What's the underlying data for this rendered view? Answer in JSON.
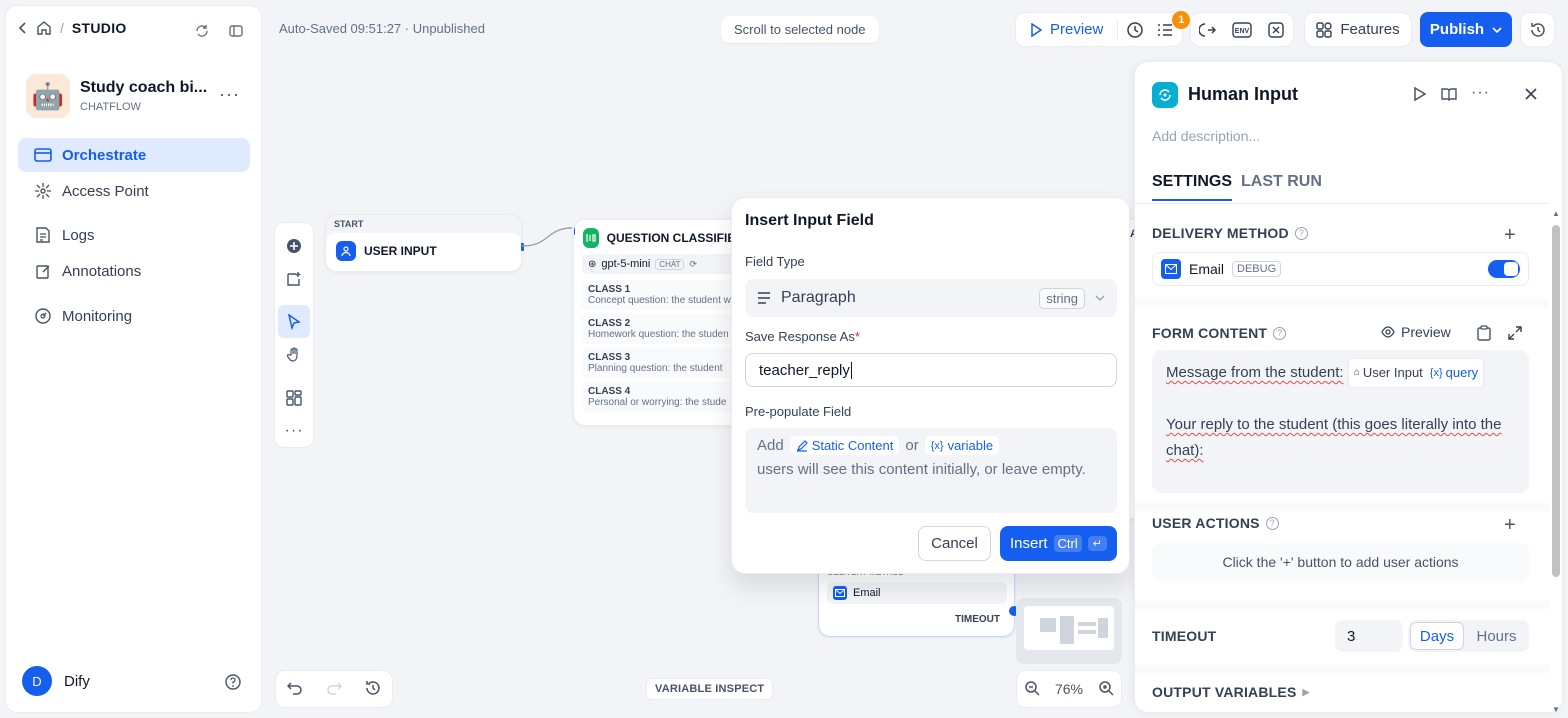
{
  "sidebar": {
    "studio": "STUDIO",
    "app_name": "Study coach bi...",
    "app_type": "CHATFLOW",
    "nav": [
      "Orchestrate",
      "Access Point",
      "Logs",
      "Annotations",
      "Monitoring"
    ],
    "user_initial": "D",
    "user_name": "Dify"
  },
  "header": {
    "autosave": "Auto-Saved 09:51:27 · Unpublished",
    "scroll_to_selected": "Scroll to selected node",
    "preview": "Preview",
    "checklist_count": "1",
    "env_label": "ENV",
    "features": "Features",
    "publish": "Publish"
  },
  "canvas": {
    "start_node": {
      "tag": "START",
      "title": "USER INPUT"
    },
    "qc_node": {
      "title": "QUESTION CLASSIFIER",
      "model": "gpt-5-mini",
      "model_badge": "CHAT",
      "classes": [
        {
          "name": "CLASS 1",
          "desc": "Concept question: the student w"
        },
        {
          "name": "CLASS 2",
          "desc": "Homework question: the studen"
        },
        {
          "name": "CLASS 3",
          "desc": "Planning question: the student"
        },
        {
          "name": "CLASS 4",
          "desc": "Personal or worrying: the stude"
        }
      ]
    },
    "human_node": {
      "delivery_label": "DELIVERY METHOD",
      "email": "Email",
      "timeout": "TIMEOUT"
    },
    "variable_inspect": "VARIABLE INSPECT",
    "zoom": "76%"
  },
  "modal": {
    "title": "Insert Input Field",
    "field_type_label": "Field Type",
    "field_type_value": "Paragraph",
    "field_type_dtype": "string",
    "save_as_label": "Save Response As",
    "required_mark": "*",
    "save_as_value": "teacher_reply",
    "prepopulate_label": "Pre-populate Field",
    "add": "Add",
    "static_content": "Static Content",
    "or": "or",
    "variable": "variable",
    "prepopulate_hint": "users will see this content initially, or leave empty.",
    "cancel": "Cancel",
    "insert": "Insert",
    "insert_kbd": "Ctrl"
  },
  "panel": {
    "title": "Human Input",
    "description_placeholder": "Add description...",
    "tabs": [
      "SETTINGS",
      "LAST RUN"
    ],
    "delivery_method": "DELIVERY METHOD",
    "delivery_item": "Email",
    "delivery_badge": "DEBUG",
    "delivery_enabled": true,
    "form_content": "FORM CONTENT",
    "form_preview": "Preview",
    "form_line1": "Message from the student:",
    "form_var_node": "User Input",
    "form_var_name": "query",
    "form_line2": "Your reply to the student (this goes literally into the chat):",
    "user_actions": "USER ACTIONS",
    "user_actions_hint": "Click the '+' button to add user actions",
    "timeout": "TIMEOUT",
    "timeout_value": "3",
    "timeout_units": [
      "Days",
      "Hours"
    ],
    "timeout_selected": "Days",
    "output_variables": "OUTPUT VARIABLES"
  },
  "colors": {
    "accent": "#155eef",
    "accent_bg": "#e0eaff",
    "qc_green": "#16b364",
    "human_teal": "#06aed4"
  }
}
